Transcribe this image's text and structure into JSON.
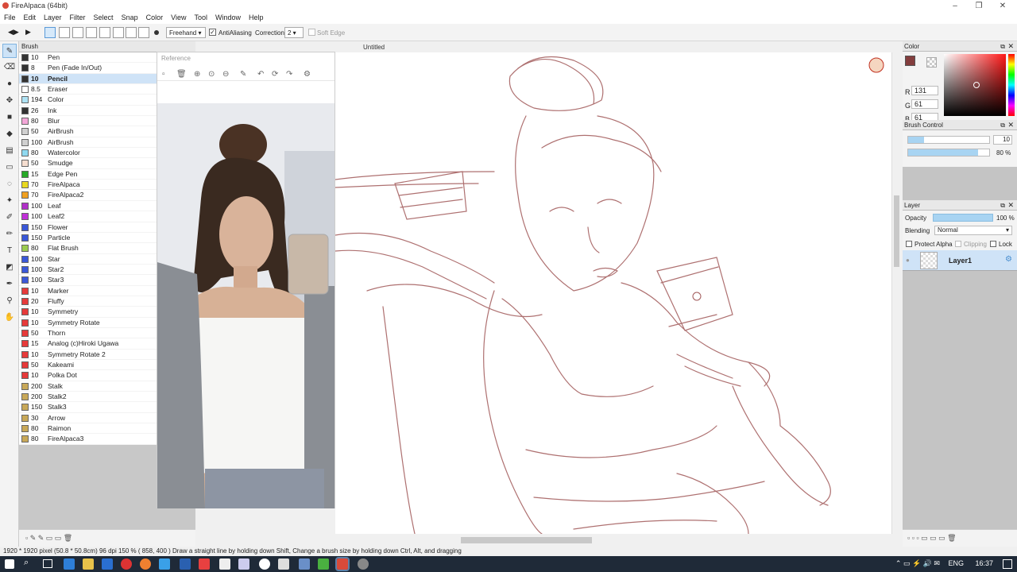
{
  "window": {
    "title": "FireAlpaca (64bit)"
  },
  "menu": [
    "File",
    "Edit",
    "Layer",
    "Filter",
    "Select",
    "Snap",
    "Color",
    "View",
    "Tool",
    "Window",
    "Help"
  ],
  "toolbar": {
    "mode": "Freehand",
    "antialiasing_label": "AntiAliasing",
    "antialiasing_checked": true,
    "correction_label": "Correction",
    "correction_value": "2",
    "soft_edge_label": "Soft Edge"
  },
  "brush_panel": {
    "title": "Brush",
    "items": [
      {
        "size": "10",
        "name": "Pen",
        "color": "#333333"
      },
      {
        "size": "8",
        "name": "Pen (Fade In/Out)",
        "color": "#333333"
      },
      {
        "size": "10",
        "name": "Pencil",
        "color": "#333333",
        "selected": true
      },
      {
        "size": "8.5",
        "name": "Eraser",
        "color": "#ffffff"
      },
      {
        "size": "194",
        "name": "Color",
        "color": "#aee3f5"
      },
      {
        "size": "26",
        "name": "Ink",
        "color": "#333333"
      },
      {
        "size": "80",
        "name": "Blur",
        "color": "#f3a6d8"
      },
      {
        "size": "50",
        "name": "AirBrush",
        "color": "#d0d0d0"
      },
      {
        "size": "100",
        "name": "AirBrush",
        "color": "#d0d0d0"
      },
      {
        "size": "80",
        "name": "Watercolor",
        "color": "#8fd9f0"
      },
      {
        "size": "50",
        "name": "Smudge",
        "color": "#f6ded0"
      },
      {
        "size": "15",
        "name": "Edge Pen",
        "color": "#27a827"
      },
      {
        "size": "70",
        "name": "FireAlpaca",
        "color": "#e8d820"
      },
      {
        "size": "70",
        "name": "FireAlpaca2",
        "color": "#f0a020"
      },
      {
        "size": "100",
        "name": "Leaf",
        "color": "#b030c8"
      },
      {
        "size": "100",
        "name": "Leaf2",
        "color": "#c030d8"
      },
      {
        "size": "150",
        "name": "Flower",
        "color": "#3a58d8"
      },
      {
        "size": "150",
        "name": "Particle",
        "color": "#3a58d8"
      },
      {
        "size": "80",
        "name": "Flat Brush",
        "color": "#9ccc50"
      },
      {
        "size": "100",
        "name": "Star",
        "color": "#3a58d8"
      },
      {
        "size": "100",
        "name": "Star2",
        "color": "#3a58d8"
      },
      {
        "size": "100",
        "name": "Star3",
        "color": "#3a58d8"
      },
      {
        "size": "10",
        "name": "Marker",
        "color": "#e63a3a"
      },
      {
        "size": "20",
        "name": "Fluffy",
        "color": "#e63a3a"
      },
      {
        "size": "10",
        "name": "Symmetry",
        "color": "#e63a3a"
      },
      {
        "size": "10",
        "name": "Symmetry Rotate",
        "color": "#e63a3a"
      },
      {
        "size": "50",
        "name": "Thorn",
        "color": "#e63a3a"
      },
      {
        "size": "15",
        "name": "Analog (c)Hiroki Ugawa",
        "color": "#e63a3a"
      },
      {
        "size": "10",
        "name": "Symmetry Rotate 2",
        "color": "#e63a3a"
      },
      {
        "size": "50",
        "name": "Kakeami",
        "color": "#e63a3a"
      },
      {
        "size": "10",
        "name": "Polka Dot",
        "color": "#e63a3a"
      },
      {
        "size": "200",
        "name": "Stalk",
        "color": "#c8a858"
      },
      {
        "size": "200",
        "name": "Stalk2",
        "color": "#c8a858"
      },
      {
        "size": "150",
        "name": "Stalk3",
        "color": "#c8a858"
      },
      {
        "size": "30",
        "name": "Arrow",
        "color": "#c8a858"
      },
      {
        "size": "80",
        "name": "Raimon",
        "color": "#c8a858"
      },
      {
        "size": "80",
        "name": "FireAlpaca3",
        "color": "#c8a858"
      }
    ]
  },
  "reference_panel": {
    "title": "Reference"
  },
  "canvas": {
    "tab_title": "Untitled",
    "stroke_color": "#a05050"
  },
  "color_panel": {
    "title": "Color",
    "r": "131",
    "g": "61",
    "b": "61",
    "r_label": "R",
    "g_label": "G",
    "b_label": "B",
    "current": "#833d3d"
  },
  "brush_control": {
    "title": "Brush Control",
    "size_value": "10",
    "opacity_value": "80 %"
  },
  "layer_panel": {
    "title": "Layer",
    "opacity_label": "Opacity",
    "opacity_value": "100 %",
    "blending_label": "Blending",
    "blending_value": "Normal",
    "protect_alpha_label": "Protect Alpha",
    "clipping_label": "Clipping",
    "lock_label": "Lock",
    "layers": [
      {
        "name": "Layer1"
      }
    ]
  },
  "status_bar": {
    "text": "1920 * 1920 pixel  (50.8 * 50.8cm)  96 dpi  150 %  ( 858, 400 )  Draw a straight line by holding down Shift, Change a brush size by holding down Ctrl, Alt, and dragging"
  },
  "taskbar": {
    "language": "ENG",
    "time": "16:37"
  }
}
